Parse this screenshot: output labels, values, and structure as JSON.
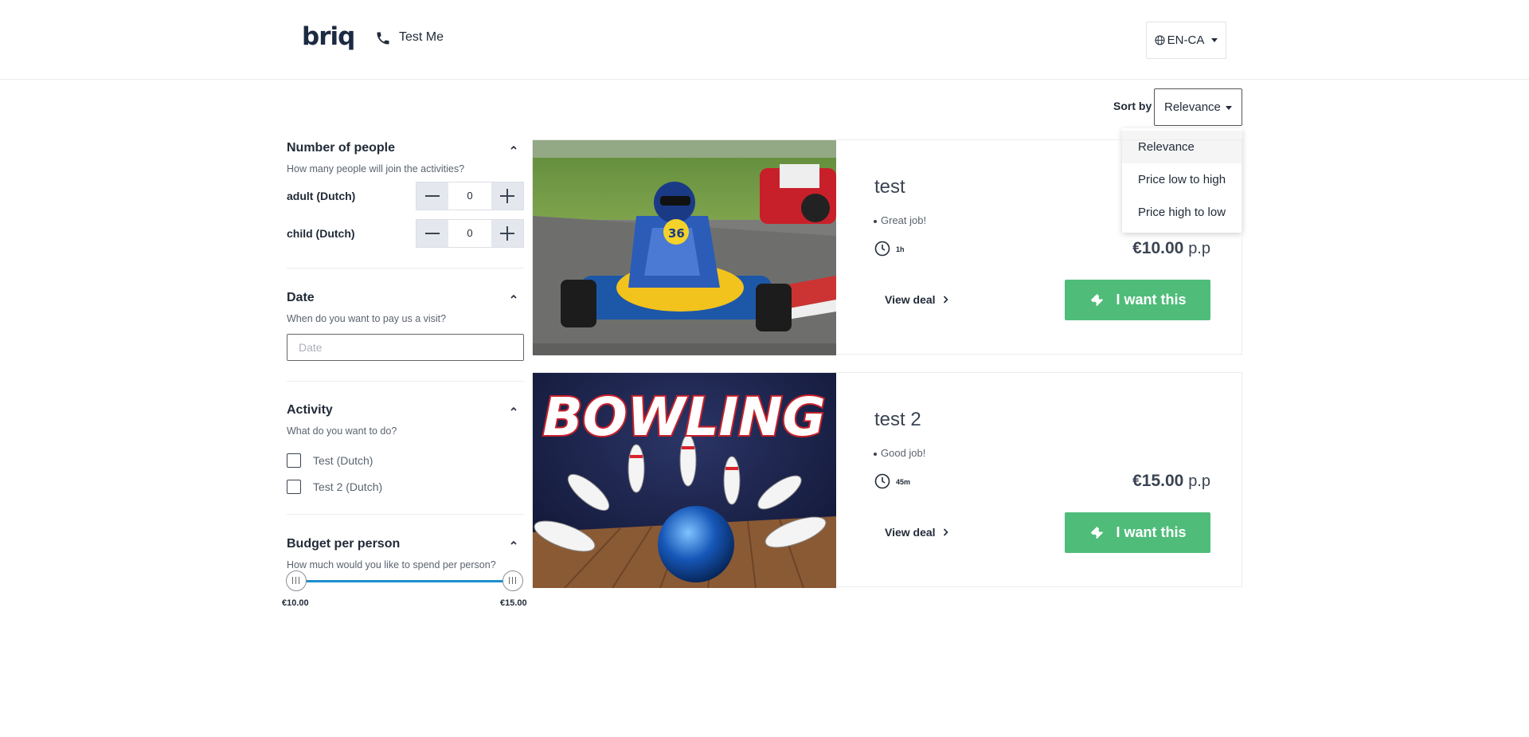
{
  "header": {
    "logo": "briq",
    "contact_label": "Test Me",
    "language": "EN-CA"
  },
  "sort": {
    "label": "Sort by",
    "selected": "Relevance",
    "options": [
      "Relevance",
      "Price low to high",
      "Price high to low"
    ]
  },
  "filters": {
    "people": {
      "title": "Number of people",
      "subtitle": "How many people will join the activities?",
      "rows": [
        {
          "label": "adult (Dutch)",
          "value": "0"
        },
        {
          "label": "child (Dutch)",
          "value": "0"
        }
      ]
    },
    "date": {
      "title": "Date",
      "subtitle": "When do you want to pay us a visit?",
      "placeholder": "Date"
    },
    "activity": {
      "title": "Activity",
      "subtitle": "What do you want to do?",
      "options": [
        "Test (Dutch)",
        "Test 2 (Dutch)"
      ]
    },
    "budget": {
      "title": "Budget per person",
      "subtitle": "How much would you like to spend per person?",
      "min_label": "€10.00",
      "max_label": "€15.00",
      "range_fraction": [
        0,
        1
      ]
    }
  },
  "deals": [
    {
      "title": "test",
      "highlight": "Great job!",
      "duration": "1h",
      "price": "€10.00",
      "price_unit": "p.p",
      "view_label": "View deal",
      "cta_label": "I want this",
      "image": "go-kart-icon"
    },
    {
      "title": "test 2",
      "highlight": "Good job!",
      "duration": "45m",
      "price": "€15.00",
      "price_unit": "p.p",
      "view_label": "View deal",
      "cta_label": "I want this",
      "image": "bowling-icon",
      "image_text": "BOWLING"
    }
  ],
  "colors": {
    "accent_green": "#4fbc7a",
    "slider_blue": "#1e8ecb",
    "logo_navy": "#1c2a42"
  }
}
